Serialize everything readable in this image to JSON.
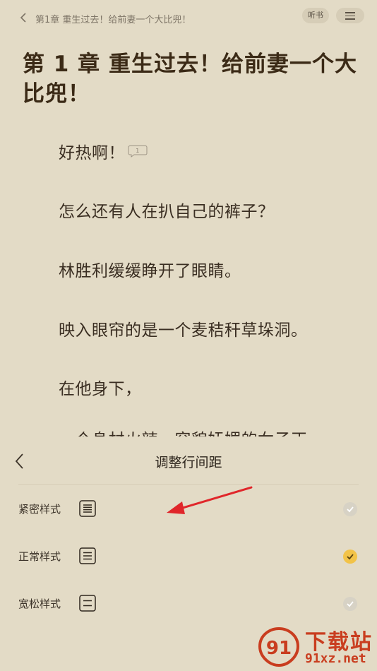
{
  "header": {
    "breadcrumb": "第1章  重生过去！给前妻一个大比兜！",
    "listen_label": "听书"
  },
  "chapter": {
    "title": "第 1 章 重生过去！给前妻一个大比兜！",
    "paragraphs": [
      "好热啊！",
      "怎么还有人在扒自己的裤子？",
      "林胜利缓缓睁开了眼睛。",
      "映入眼帘的是一个麦秸秆草垛洞。",
      "在他身下，",
      "一个身材火辣，容貌妩媚的女子正"
    ],
    "comment_count": "1"
  },
  "panel": {
    "title": "调整行间距",
    "options": [
      {
        "label": "紧密样式",
        "icon": "spacing-tight-icon",
        "selected": false
      },
      {
        "label": "正常样式",
        "icon": "spacing-normal-icon",
        "selected": true
      },
      {
        "label": "宽松样式",
        "icon": "spacing-loose-icon",
        "selected": false
      }
    ]
  },
  "watermark": {
    "brand": "下载站",
    "url": "91xz.net",
    "logo_digits": "91"
  },
  "colors": {
    "background": "#e3dbc6",
    "title": "#3b2a16",
    "check_active": "#f2c348",
    "check_inactive": "#d7d2c5",
    "annotation_arrow": "#e0262a",
    "watermark": "#c93d1f"
  }
}
